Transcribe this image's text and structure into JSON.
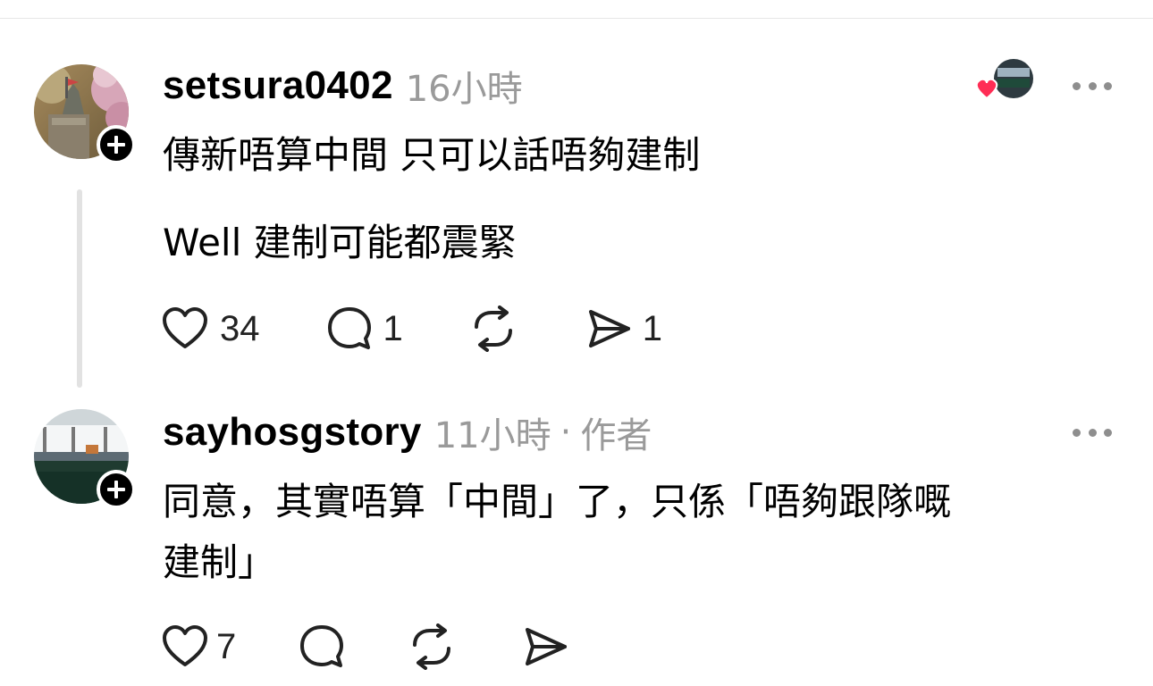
{
  "posts": [
    {
      "username": "setsura0402",
      "time": "16小時",
      "paragraphs": [
        "傳新唔算中間 只可以話唔夠建制",
        "Well 建制可能都震緊"
      ],
      "counts": {
        "likes": "34",
        "replies": "1",
        "reposts": "",
        "shares": "1"
      },
      "liked_by_author": true
    },
    {
      "username": "sayhosgstory",
      "time": "11小時",
      "author_tag": "作者",
      "separator": "·",
      "lines": [
        "同意，其實唔算「中間」了，只係「唔夠跟隊嘅",
        "建制」"
      ],
      "counts": {
        "likes": "7",
        "replies": "",
        "reposts": "",
        "shares": ""
      }
    }
  ],
  "icons": {
    "like": "heart-outline-icon",
    "reply": "speech-bubble-icon",
    "repost": "repost-arrows-icon",
    "share": "paper-plane-icon",
    "more": "more-dots-icon",
    "follow": "plus-icon"
  },
  "colors": {
    "like_heart": "#ff2d55",
    "meta_text": "#9a9a9a",
    "divider": "#e2e2e2"
  }
}
